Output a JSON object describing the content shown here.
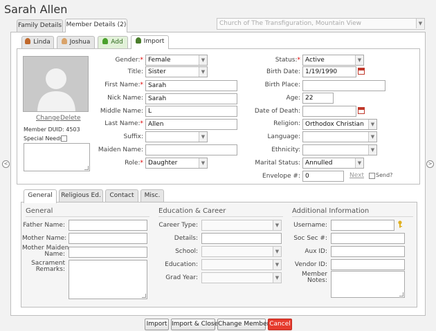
{
  "title": "Sarah Allen",
  "main_tabs": [
    "Family Details",
    "Member Details (2)"
  ],
  "church": "Church of The Transfiguration, Mountain View",
  "member_tabs": [
    "Linda",
    "Joshua",
    "Add",
    "Import"
  ],
  "photo": {
    "change": "Change",
    "delete": "Delete",
    "duid_label": "Member DUID:",
    "duid_value": "4503",
    "special_needs_label": "Special Needs:"
  },
  "left_fields": {
    "gender": {
      "label": "Gender:",
      "value": "Female"
    },
    "title": {
      "label": "Title:",
      "value": "Sister"
    },
    "first_name": {
      "label": "First Name:",
      "value": "Sarah"
    },
    "nick_name": {
      "label": "Nick Name:",
      "value": "Sarah"
    },
    "middle_name": {
      "label": "Middle Name:",
      "value": "L"
    },
    "last_name": {
      "label": "Last Name:",
      "value": "Allen"
    },
    "suffix": {
      "label": "Suffix:",
      "value": ""
    },
    "maiden_name": {
      "label": "Maiden Name:",
      "value": ""
    },
    "role": {
      "label": "Role:",
      "value": "Daughter"
    }
  },
  "right_fields": {
    "status": {
      "label": "Status:",
      "value": "Active"
    },
    "birth_date": {
      "label": "Birth Date:",
      "value": "1/19/1990"
    },
    "birth_place": {
      "label": "Birth Place:",
      "value": ""
    },
    "age": {
      "label": "Age:",
      "value": "22"
    },
    "date_of_death": {
      "label": "Date of Death:",
      "value": ""
    },
    "religion": {
      "label": "Religion:",
      "value": "Orthodox Christian"
    },
    "language": {
      "label": "Language:",
      "value": ""
    },
    "ethnicity": {
      "label": "Ethnicity:",
      "value": ""
    },
    "marital_status": {
      "label": "Marital Status:",
      "value": "Annulled"
    },
    "envelope": {
      "label": "Envelope #:",
      "value": "0",
      "next": "Next",
      "send": "Send?"
    }
  },
  "sub_tabs": [
    "General",
    "Religious Ed.",
    "Contact",
    "Misc."
  ],
  "general": {
    "heading": "General",
    "father_name": "Father Name:",
    "mother_name": "Mother Name:",
    "mother_maiden_1": "Mother Maiden",
    "mother_maiden_2": "Name:",
    "sacrament_1": "Sacrament",
    "sacrament_2": "Remarks:"
  },
  "education": {
    "heading": "Education & Career",
    "career_type": "Career Type:",
    "details": "Details:",
    "school": "School:",
    "education": "Education:",
    "grad_year": "Grad Year:"
  },
  "additional": {
    "heading": "Additional Information",
    "username": "Username:",
    "soc_sec": "Soc Sec #:",
    "aux_id": "Aux ID:",
    "vendor_id": "Vendor ID:",
    "member_notes_1": "Member",
    "member_notes_2": "Notes:"
  },
  "buttons": [
    "Import",
    "Import & Close",
    "Change Member",
    "Cancel"
  ]
}
